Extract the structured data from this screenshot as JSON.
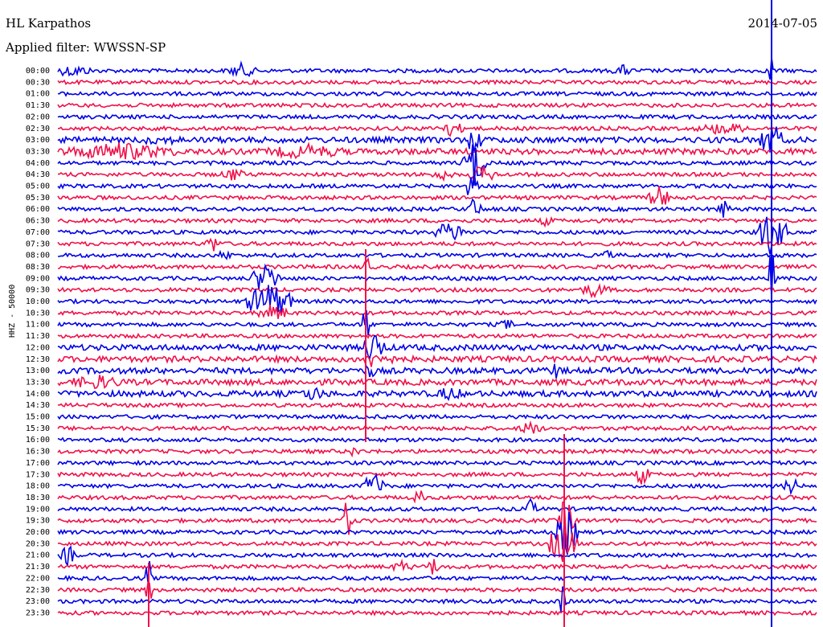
{
  "header": {
    "station": "HL Karpathos",
    "date": "2014-07-05",
    "filter": "Applied filter: WWSSN-SP"
  },
  "chart_data": {
    "type": "line",
    "title": "HL Karpathos",
    "ylabel": "HHZ - 50000",
    "row_labels": [
      "00:00",
      "00:30",
      "01:00",
      "01:30",
      "02:00",
      "02:30",
      "03:00",
      "03:30",
      "04:00",
      "04:30",
      "05:00",
      "05:30",
      "06:00",
      "06:30",
      "07:00",
      "07:30",
      "08:00",
      "08:30",
      "09:00",
      "09:30",
      "10:00",
      "10:30",
      "11:00",
      "11:30",
      "12:00",
      "12:30",
      "13:00",
      "13:30",
      "14:00",
      "14:30",
      "15:00",
      "15:30",
      "16:00",
      "16:30",
      "17:00",
      "17:30",
      "18:00",
      "18:30",
      "19:00",
      "19:30",
      "20:00",
      "20:30",
      "21:00",
      "21:30",
      "22:00",
      "22:30",
      "23:00",
      "23:30"
    ],
    "colors": [
      "#0000e6",
      "#f0104a"
    ]
  }
}
